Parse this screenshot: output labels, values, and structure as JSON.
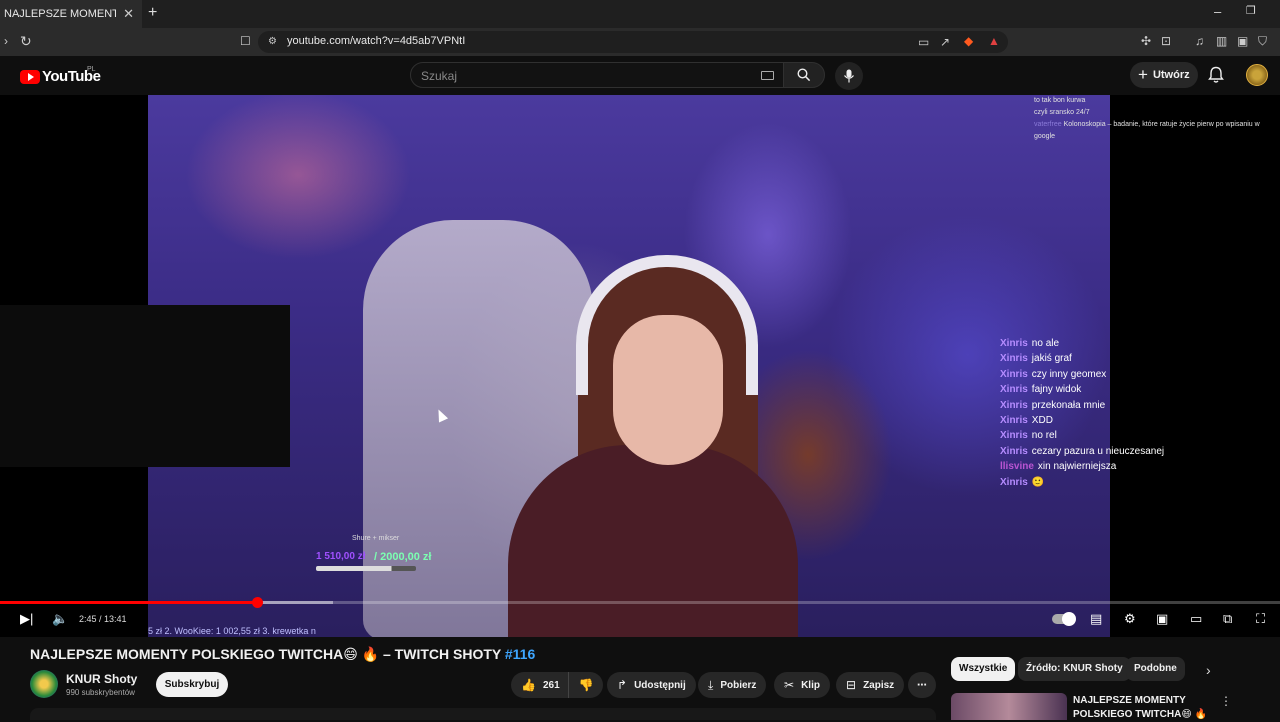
{
  "browser": {
    "tab_title": "NAJLEPSZE MOMENTY POLSKIEGO",
    "url": "youtube.com/watch?v=4d5ab7VPNtI",
    "new_tab_label": "+",
    "minimize_label": "–",
    "restore_label": "❐"
  },
  "header": {
    "logo_text": "YouTube",
    "region": "PL",
    "search_placeholder": "Szukaj",
    "create_label": "Utwórz"
  },
  "video": {
    "chat_top": [
      {
        "user": "",
        "text": "to tak bon kurwa"
      },
      {
        "user": "",
        "text": ""
      },
      {
        "user": "",
        "text": "czyli sransko 24/7"
      },
      {
        "user": "vaterfree",
        "text": "Kolonoskopia – badanie, które ratuje życie pierw po wpisaniu w google"
      }
    ],
    "chat_side": [
      {
        "user": "Xinris",
        "text": "no ale"
      },
      {
        "user": "Xinris",
        "text": "jakiś graf"
      },
      {
        "user": "Xinris",
        "text": "czy inny geomex"
      },
      {
        "user": "Xinris",
        "text": "fajny widok"
      },
      {
        "user": "Xinris",
        "text": "przekonała mnie"
      },
      {
        "user": "Xinris",
        "text": "XDD"
      },
      {
        "user": "Xinris",
        "text": "no rel"
      },
      {
        "user": "Xinris",
        "text": "cezary pazura u nieuczesanej"
      },
      {
        "user": "llisvine",
        "text": "xin najwierniejsza"
      },
      {
        "user": "Xinris",
        "text": "🙂"
      }
    ],
    "donation_label": "Shure + mikser",
    "donation_current": "1 510,00 zł",
    "donation_goal": "/ 2000,00 zł",
    "donation_progress": 0.755,
    "leaderboard": "5 zł 2. WooKiee: 1 002,55 zł 3. krewetka n"
  },
  "player": {
    "time": "2:45 / 13:41",
    "progress": 0.2009,
    "buffered": 0.26
  },
  "details": {
    "title": "NAJLEPSZE MOMENTY POLSKIEGO TWITCHA😄 🔥 – TWITCH SHOTY",
    "title_tag": "#116",
    "channel_name": "KNUR Shoty",
    "channel_subs": "990 subskrybentów",
    "subscribe_label": "Subskrybuj",
    "likes": "261",
    "share_label": "Udostępnij",
    "download_label": "Pobierz",
    "clip_label": "Klip",
    "save_label": "Zapisz"
  },
  "sidebar": {
    "chips": [
      "Wszystkie",
      "Źródło: KNUR Shoty",
      "Podobne"
    ],
    "rec_title": "NAJLEPSZE MOMENTY",
    "rec_title2": "POLSKIEGO TWITCHA😄 🔥"
  },
  "colors": {
    "accent": "#ff0000",
    "chat_user": "#b58cff",
    "link": "#3ea6ff"
  }
}
